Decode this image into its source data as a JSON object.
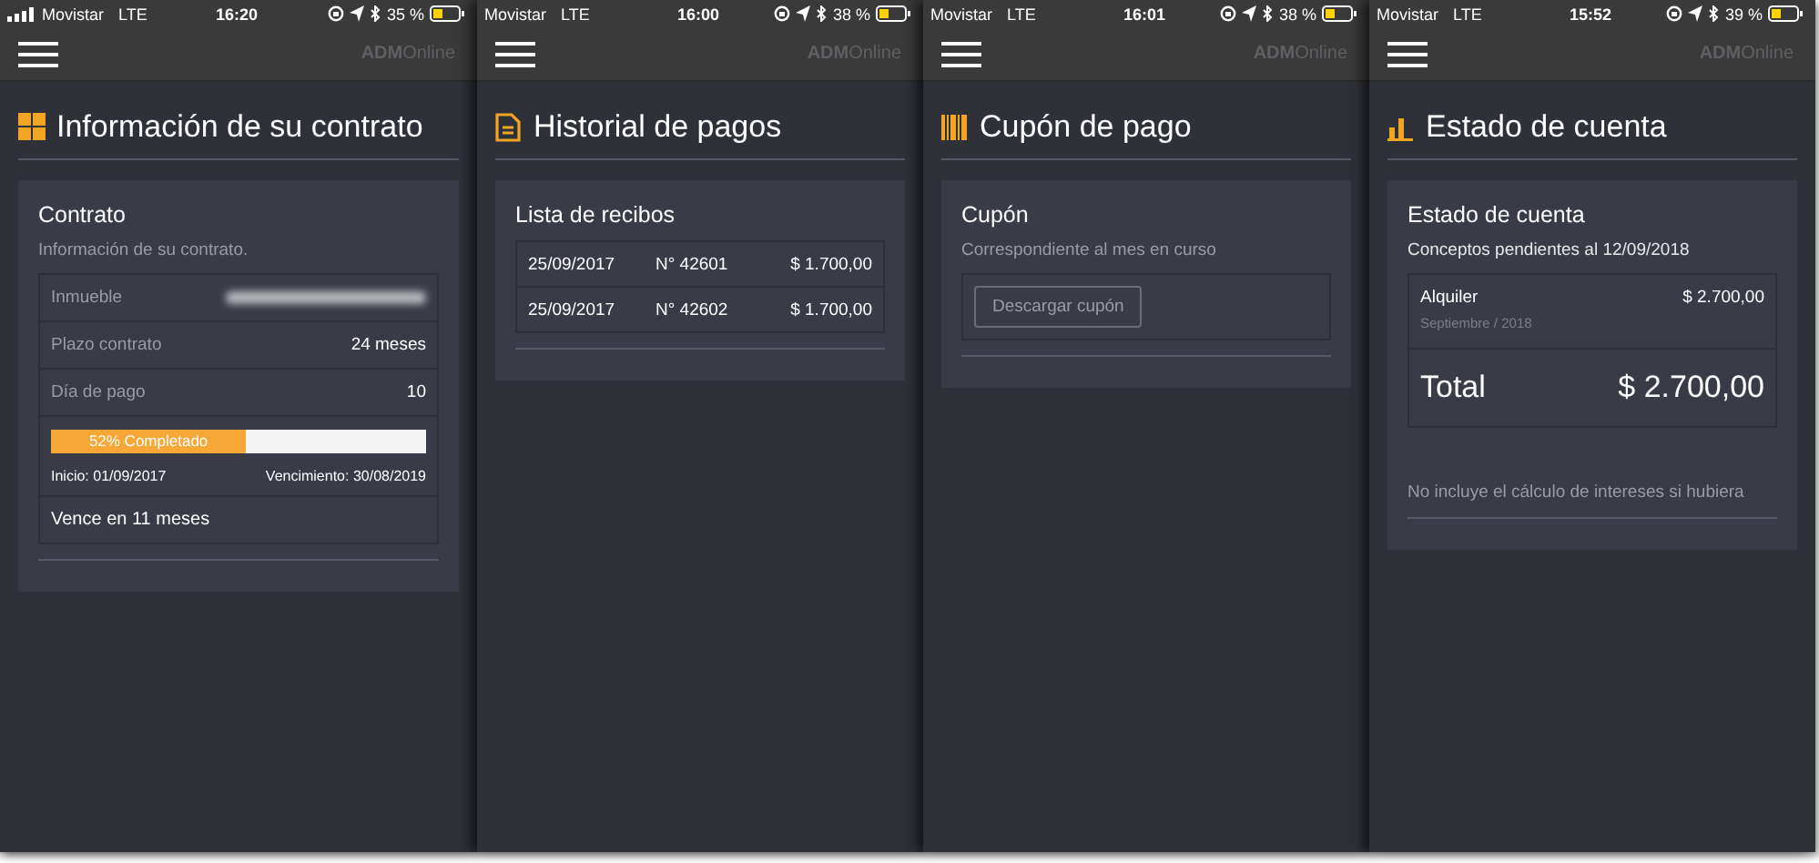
{
  "screens": [
    {
      "status": {
        "carrier": "Movistar",
        "network": "LTE",
        "time": "16:20",
        "battery": "35 %"
      },
      "logo": {
        "bold": "ADM",
        "light": "Online"
      },
      "page_title": "Información de su contrato",
      "card": {
        "kind": "contract",
        "title": "Contrato",
        "subtitle": "Información de su contrato.",
        "rows": [
          {
            "label": "Inmueble",
            "redacted": true
          },
          {
            "label": "Plazo contrato",
            "value": "24 meses",
            "redacted": false
          },
          {
            "label": "Día de pago",
            "value": "10",
            "redacted": false
          }
        ],
        "progress": {
          "label": "52% Completado",
          "level": 0.52
        },
        "start": "Inicio: 01/09/2017",
        "end": "Vencimiento: 30/08/2019",
        "footer": "Vence en 11 meses"
      }
    },
    {
      "status": {
        "carrier": "Movistar",
        "network": "LTE",
        "time": "16:00",
        "battery": "38 %"
      },
      "logo": {
        "bold": "ADM",
        "light": "Online"
      },
      "page_title": "Historial de pagos",
      "card": {
        "kind": "receipts",
        "title": "Lista de recibos",
        "rows": [
          {
            "date": "25/09/2017",
            "number": "N° 42601",
            "amount": "$ 1.700,00"
          },
          {
            "date": "25/09/2017",
            "number": "N° 42602",
            "amount": "$ 1.700,00"
          }
        ]
      }
    },
    {
      "status": {
        "carrier": "Movistar",
        "network": "LTE",
        "time": "16:01",
        "battery": "38 %"
      },
      "logo": {
        "bold": "ADM",
        "light": "Online"
      },
      "page_title": "Cupón de pago",
      "card": {
        "kind": "coupon",
        "title": "Cupón",
        "subtitle": "Correspondiente al mes en curso",
        "button": "Descargar cupón"
      }
    },
    {
      "status": {
        "carrier": "Movistar",
        "network": "LTE",
        "time": "15:52",
        "battery": "39 %"
      },
      "logo": {
        "bold": "ADM",
        "light": "Online"
      },
      "page_title": "Estado de cuenta",
      "card": {
        "kind": "account",
        "title": "Estado de cuenta",
        "subtitle": "Conceptos pendientes al 12/09/2018",
        "items": [
          {
            "name": "Alquiler",
            "detail": "Septiembre / 2018",
            "amount": "$ 2.700,00"
          }
        ],
        "total": {
          "label": "Total",
          "amount": "$ 2.700,00"
        },
        "note": "No incluye el cálculo de intereses si hubiera"
      }
    }
  ]
}
